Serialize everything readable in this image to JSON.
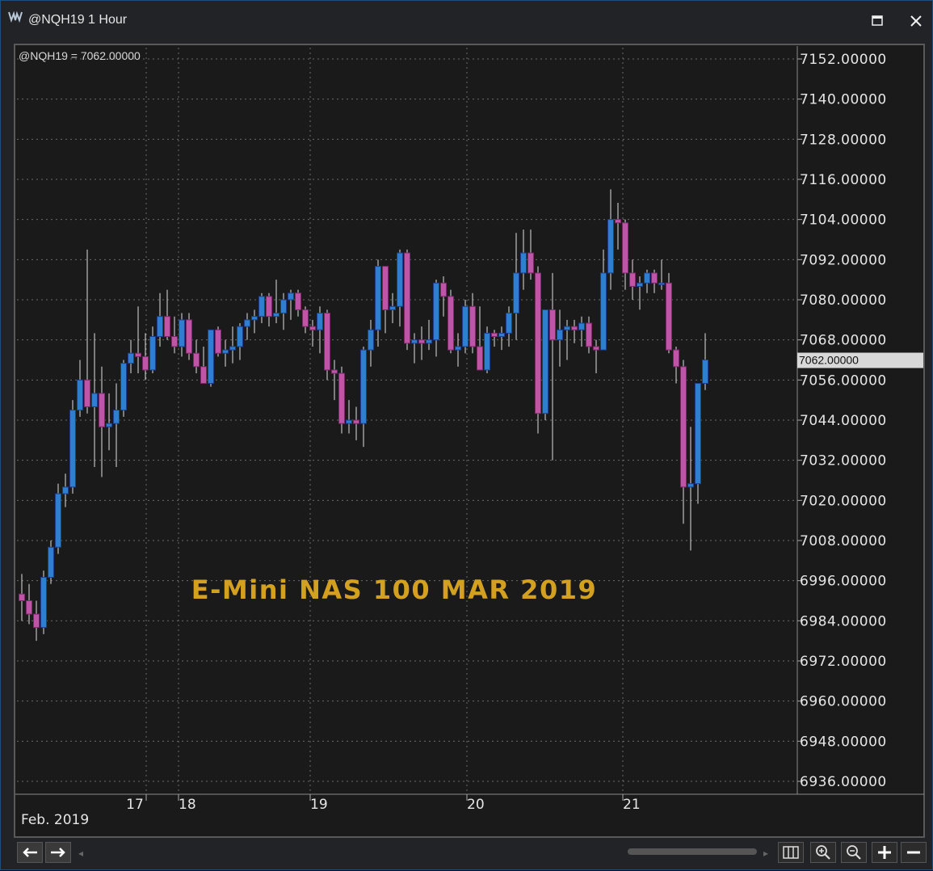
{
  "window": {
    "title": "@NQH19 1 Hour",
    "maximize_icon": "maximize-icon",
    "close_icon": "close-icon"
  },
  "chart_header": {
    "symbol_value": "@NQH19 = 7062.00000"
  },
  "watermark": {
    "text": "E-Mini NAS 100 MAR 2019",
    "color": "#d4a020"
  },
  "colors": {
    "up_candle": "#2f7fd0",
    "down_candle": "#c055a8",
    "wick": "#e0e0e0",
    "grid": "#6a6a6a",
    "axis_text": "#e6e6e6",
    "price_marker_bg": "#d8d8d8"
  },
  "chart_data": {
    "type": "candlestick",
    "title": "",
    "ylabel": "",
    "ylim": [
      6932,
      7156
    ],
    "y_ticks": [
      "7152.00000",
      "7140.00000",
      "7128.00000",
      "7116.00000",
      "7104.00000",
      "7092.00000",
      "7080.00000",
      "7068.00000",
      "7056.00000",
      "7044.00000",
      "7032.00000",
      "7020.00000",
      "7008.00000",
      "6996.00000",
      "6984.00000",
      "6972.00000",
      "6960.00000",
      "6948.00000",
      "6936.00000"
    ],
    "x_ticks": [
      "17",
      "18",
      "19",
      "20",
      "21"
    ],
    "x_axis_month": "Feb. 2019",
    "last_price": "7062.00000",
    "candles": [
      {
        "o": 6992,
        "h": 6998,
        "l": 6984,
        "c": 6990
      },
      {
        "o": 6990,
        "h": 6995,
        "l": 6983,
        "c": 6986
      },
      {
        "o": 6986,
        "h": 6990,
        "l": 6978,
        "c": 6982
      },
      {
        "o": 6982,
        "h": 6999,
        "l": 6980,
        "c": 6997
      },
      {
        "o": 6997,
        "h": 7008,
        "l": 6995,
        "c": 7006
      },
      {
        "o": 7006,
        "h": 7025,
        "l": 7004,
        "c": 7022
      },
      {
        "o": 7022,
        "h": 7028,
        "l": 7018,
        "c": 7024
      },
      {
        "o": 7024,
        "h": 7050,
        "l": 7022,
        "c": 7047
      },
      {
        "o": 7047,
        "h": 7062,
        "l": 7045,
        "c": 7056
      },
      {
        "o": 7056,
        "h": 7095,
        "l": 7046,
        "c": 7048
      },
      {
        "o": 7048,
        "h": 7070,
        "l": 7030,
        "c": 7052
      },
      {
        "o": 7052,
        "h": 7060,
        "l": 7027,
        "c": 7042
      },
      {
        "o": 7042,
        "h": 7052,
        "l": 7035,
        "c": 7043
      },
      {
        "o": 7043,
        "h": 7055,
        "l": 7030,
        "c": 7047
      },
      {
        "o": 7047,
        "h": 7062,
        "l": 7045,
        "c": 7061
      },
      {
        "o": 7061,
        "h": 7068,
        "l": 7058,
        "c": 7064
      },
      {
        "o": 7064,
        "h": 7078,
        "l": 7058,
        "c": 7063
      },
      {
        "o": 7063,
        "h": 7070,
        "l": 7056,
        "c": 7059
      },
      {
        "o": 7059,
        "h": 7072,
        "l": 7058,
        "c": 7069
      },
      {
        "o": 7069,
        "h": 7082,
        "l": 7066,
        "c": 7075
      },
      {
        "o": 7075,
        "h": 7083,
        "l": 7068,
        "c": 7069
      },
      {
        "o": 7069,
        "h": 7075,
        "l": 7064,
        "c": 7066
      },
      {
        "o": 7066,
        "h": 7076,
        "l": 7063,
        "c": 7074
      },
      {
        "o": 7074,
        "h": 7076,
        "l": 7062,
        "c": 7064
      },
      {
        "o": 7064,
        "h": 7068,
        "l": 7058,
        "c": 7060
      },
      {
        "o": 7060,
        "h": 7066,
        "l": 7056,
        "c": 7055
      },
      {
        "o": 7055,
        "h": 7070,
        "l": 7054,
        "c": 7071
      },
      {
        "o": 7071,
        "h": 7072,
        "l": 7063,
        "c": 7064
      },
      {
        "o": 7064,
        "h": 7068,
        "l": 7060,
        "c": 7065
      },
      {
        "o": 7065,
        "h": 7072,
        "l": 7061,
        "c": 7066
      },
      {
        "o": 7066,
        "h": 7073,
        "l": 7062,
        "c": 7072
      },
      {
        "o": 7072,
        "h": 7076,
        "l": 7068,
        "c": 7074
      },
      {
        "o": 7074,
        "h": 7077,
        "l": 7070,
        "c": 7075
      },
      {
        "o": 7075,
        "h": 7082,
        "l": 7073,
        "c": 7081
      },
      {
        "o": 7081,
        "h": 7082,
        "l": 7072,
        "c": 7075
      },
      {
        "o": 7075,
        "h": 7086,
        "l": 7073,
        "c": 7076
      },
      {
        "o": 7076,
        "h": 7082,
        "l": 7071,
        "c": 7080
      },
      {
        "o": 7080,
        "h": 7083,
        "l": 7074,
        "c": 7082
      },
      {
        "o": 7082,
        "h": 7083,
        "l": 7075,
        "c": 7077
      },
      {
        "o": 7077,
        "h": 7078,
        "l": 7070,
        "c": 7072
      },
      {
        "o": 7072,
        "h": 7074,
        "l": 7066,
        "c": 7071
      },
      {
        "o": 7071,
        "h": 7078,
        "l": 7064,
        "c": 7076
      },
      {
        "o": 7076,
        "h": 7077,
        "l": 7056,
        "c": 7059
      },
      {
        "o": 7059,
        "h": 7062,
        "l": 7050,
        "c": 7058
      },
      {
        "o": 7058,
        "h": 7060,
        "l": 7040,
        "c": 7043
      },
      {
        "o": 7043,
        "h": 7050,
        "l": 7040,
        "c": 7044
      },
      {
        "o": 7044,
        "h": 7048,
        "l": 7038,
        "c": 7043
      },
      {
        "o": 7043,
        "h": 7066,
        "l": 7036,
        "c": 7065
      },
      {
        "o": 7065,
        "h": 7074,
        "l": 7060,
        "c": 7071
      },
      {
        "o": 7071,
        "h": 7092,
        "l": 7066,
        "c": 7090
      },
      {
        "o": 7090,
        "h": 7090,
        "l": 7070,
        "c": 7077
      },
      {
        "o": 7077,
        "h": 7082,
        "l": 7073,
        "c": 7078
      },
      {
        "o": 7078,
        "h": 7095,
        "l": 7072,
        "c": 7094
      },
      {
        "o": 7094,
        "h": 7095,
        "l": 7065,
        "c": 7067
      },
      {
        "o": 7067,
        "h": 7070,
        "l": 7061,
        "c": 7068
      },
      {
        "o": 7068,
        "h": 7072,
        "l": 7062,
        "c": 7067
      },
      {
        "o": 7067,
        "h": 7074,
        "l": 7065,
        "c": 7068
      },
      {
        "o": 7068,
        "h": 7086,
        "l": 7063,
        "c": 7085
      },
      {
        "o": 7085,
        "h": 7087,
        "l": 7075,
        "c": 7081
      },
      {
        "o": 7081,
        "h": 7083,
        "l": 7064,
        "c": 7065
      },
      {
        "o": 7065,
        "h": 7070,
        "l": 7060,
        "c": 7066
      },
      {
        "o": 7066,
        "h": 7080,
        "l": 7064,
        "c": 7078
      },
      {
        "o": 7078,
        "h": 7082,
        "l": 7064,
        "c": 7066
      },
      {
        "o": 7066,
        "h": 7078,
        "l": 7060,
        "c": 7059
      },
      {
        "o": 7059,
        "h": 7072,
        "l": 7058,
        "c": 7070
      },
      {
        "o": 7070,
        "h": 7071,
        "l": 7066,
        "c": 7069
      },
      {
        "o": 7069,
        "h": 7072,
        "l": 7065,
        "c": 7070
      },
      {
        "o": 7070,
        "h": 7078,
        "l": 7066,
        "c": 7076
      },
      {
        "o": 7076,
        "h": 7100,
        "l": 7068,
        "c": 7088
      },
      {
        "o": 7088,
        "h": 7101,
        "l": 7083,
        "c": 7094
      },
      {
        "o": 7094,
        "h": 7101,
        "l": 7086,
        "c": 7088
      },
      {
        "o": 7088,
        "h": 7090,
        "l": 7040,
        "c": 7046
      },
      {
        "o": 7046,
        "h": 7077,
        "l": 7044,
        "c": 7077
      },
      {
        "o": 7077,
        "h": 7088,
        "l": 7032,
        "c": 7068
      },
      {
        "o": 7068,
        "h": 7077,
        "l": 7060,
        "c": 7071
      },
      {
        "o": 7071,
        "h": 7074,
        "l": 7062,
        "c": 7072
      },
      {
        "o": 7072,
        "h": 7074,
        "l": 7067,
        "c": 7071
      },
      {
        "o": 7071,
        "h": 7075,
        "l": 7066,
        "c": 7073
      },
      {
        "o": 7073,
        "h": 7075,
        "l": 7064,
        "c": 7066
      },
      {
        "o": 7066,
        "h": 7068,
        "l": 7058,
        "c": 7065
      },
      {
        "o": 7065,
        "h": 7095,
        "l": 7066,
        "c": 7088
      },
      {
        "o": 7088,
        "h": 7113,
        "l": 7083,
        "c": 7104
      },
      {
        "o": 7104,
        "h": 7109,
        "l": 7095,
        "c": 7103
      },
      {
        "o": 7103,
        "h": 7104,
        "l": 7083,
        "c": 7088
      },
      {
        "o": 7088,
        "h": 7092,
        "l": 7080,
        "c": 7084
      },
      {
        "o": 7084,
        "h": 7087,
        "l": 7077,
        "c": 7085
      },
      {
        "o": 7085,
        "h": 7089,
        "l": 7082,
        "c": 7088
      },
      {
        "o": 7088,
        "h": 7089,
        "l": 7082,
        "c": 7085
      },
      {
        "o": 7085,
        "h": 7092,
        "l": 7083,
        "c": 7085
      },
      {
        "o": 7085,
        "h": 7088,
        "l": 7064,
        "c": 7065
      },
      {
        "o": 7065,
        "h": 7066,
        "l": 7055,
        "c": 7060
      },
      {
        "o": 7060,
        "h": 7062,
        "l": 7013,
        "c": 7024
      },
      {
        "o": 7024,
        "h": 7042,
        "l": 7005,
        "c": 7025
      },
      {
        "o": 7025,
        "h": 7046,
        "l": 7019,
        "c": 7055
      },
      {
        "o": 7055,
        "h": 7070,
        "l": 7053,
        "c": 7062
      }
    ]
  },
  "footer": {
    "back_icon": "arrow-left-icon",
    "forward_icon": "arrow-right-icon",
    "bars_icon": "bar-spacing-icon",
    "zoom_in_icon": "zoom-in-icon",
    "zoom_out_icon": "zoom-out-icon",
    "plus_icon": "plus-icon",
    "minus_icon": "minus-icon"
  }
}
